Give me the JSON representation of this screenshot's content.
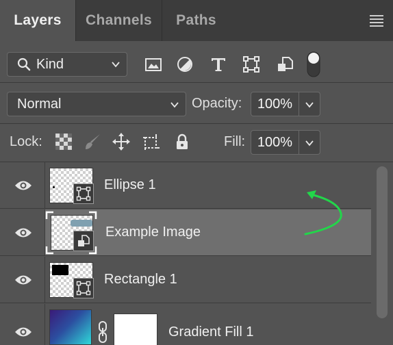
{
  "tabs": [
    {
      "label": "Layers",
      "active": true
    },
    {
      "label": "Channels",
      "active": false
    },
    {
      "label": "Paths",
      "active": false
    }
  ],
  "filter": {
    "kind_label": "Kind",
    "icons": [
      "image-filter-icon",
      "adjustment-filter-icon",
      "type-filter-icon",
      "shape-filter-icon",
      "smart-object-filter-icon",
      "filter-toggle-icon"
    ]
  },
  "blend": {
    "mode": "Normal",
    "opacity_label": "Opacity:",
    "opacity_value": "100%"
  },
  "lock": {
    "label": "Lock:",
    "fill_label": "Fill:",
    "fill_value": "100%",
    "icons": [
      "lock-transparent-pixels-icon",
      "lock-image-pixels-icon",
      "lock-position-icon",
      "lock-artboard-icon",
      "lock-all-icon"
    ]
  },
  "layers": [
    {
      "name": "Ellipse 1",
      "selected": false,
      "type": "shape"
    },
    {
      "name": "Example Image",
      "selected": true,
      "type": "smart-object"
    },
    {
      "name": "Rectangle 1",
      "selected": false,
      "type": "shape"
    },
    {
      "name": "Gradient Fill 1",
      "selected": false,
      "type": "fill"
    }
  ],
  "colors": {
    "panel": "#535353",
    "tabbar": "#3c3c3c",
    "selected_row": "#6f6f6f",
    "annotation_arrow": "#22d64a"
  }
}
